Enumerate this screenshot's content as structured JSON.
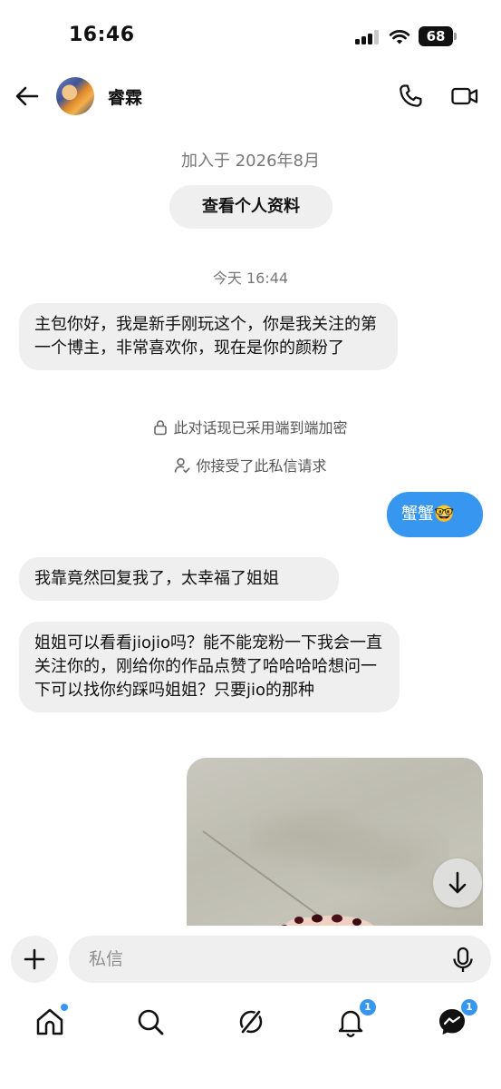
{
  "status_bar": {
    "time": "16:46",
    "battery": "68"
  },
  "header": {
    "contact_name": "睿霖",
    "icons": [
      "back-arrow-icon",
      "phone-icon",
      "video-camera-icon"
    ]
  },
  "conversation": {
    "joined_text": "加入于 2026年8月",
    "view_profile_label": "查看个人资料",
    "timestamp": "今天 16:44",
    "messages": [
      {
        "direction": "in",
        "text": "主包你好，我是新手刚玩这个，你是我关注的第一个博主，非常喜欢你，现在是你的颜粉了"
      },
      {
        "direction": "out",
        "text": "蟹蟹🤓"
      },
      {
        "direction": "in",
        "text": "我靠竟然回复我了，太幸福了姐姐"
      },
      {
        "direction": "in",
        "text": "姐姐可以看看jiojio吗？能不能宠粉一下我会一直关注你的，刚给你的作品点赞了哈哈哈哈想问一下可以找你约踩吗姐姐？只要jio的那种"
      }
    ],
    "notices": {
      "encryption": "此对话现已采用端到端加密",
      "accepted": "你接受了此私信请求"
    }
  },
  "composer": {
    "placeholder": "私信"
  },
  "bottom_nav": {
    "items": [
      "home-icon",
      "search-icon",
      "explore-icon",
      "notifications-icon",
      "messages-icon"
    ],
    "notifications_badge": "1",
    "messages_badge": "1"
  },
  "colors": {
    "accent": "#3797f0",
    "bubble_gray": "#efefef"
  }
}
